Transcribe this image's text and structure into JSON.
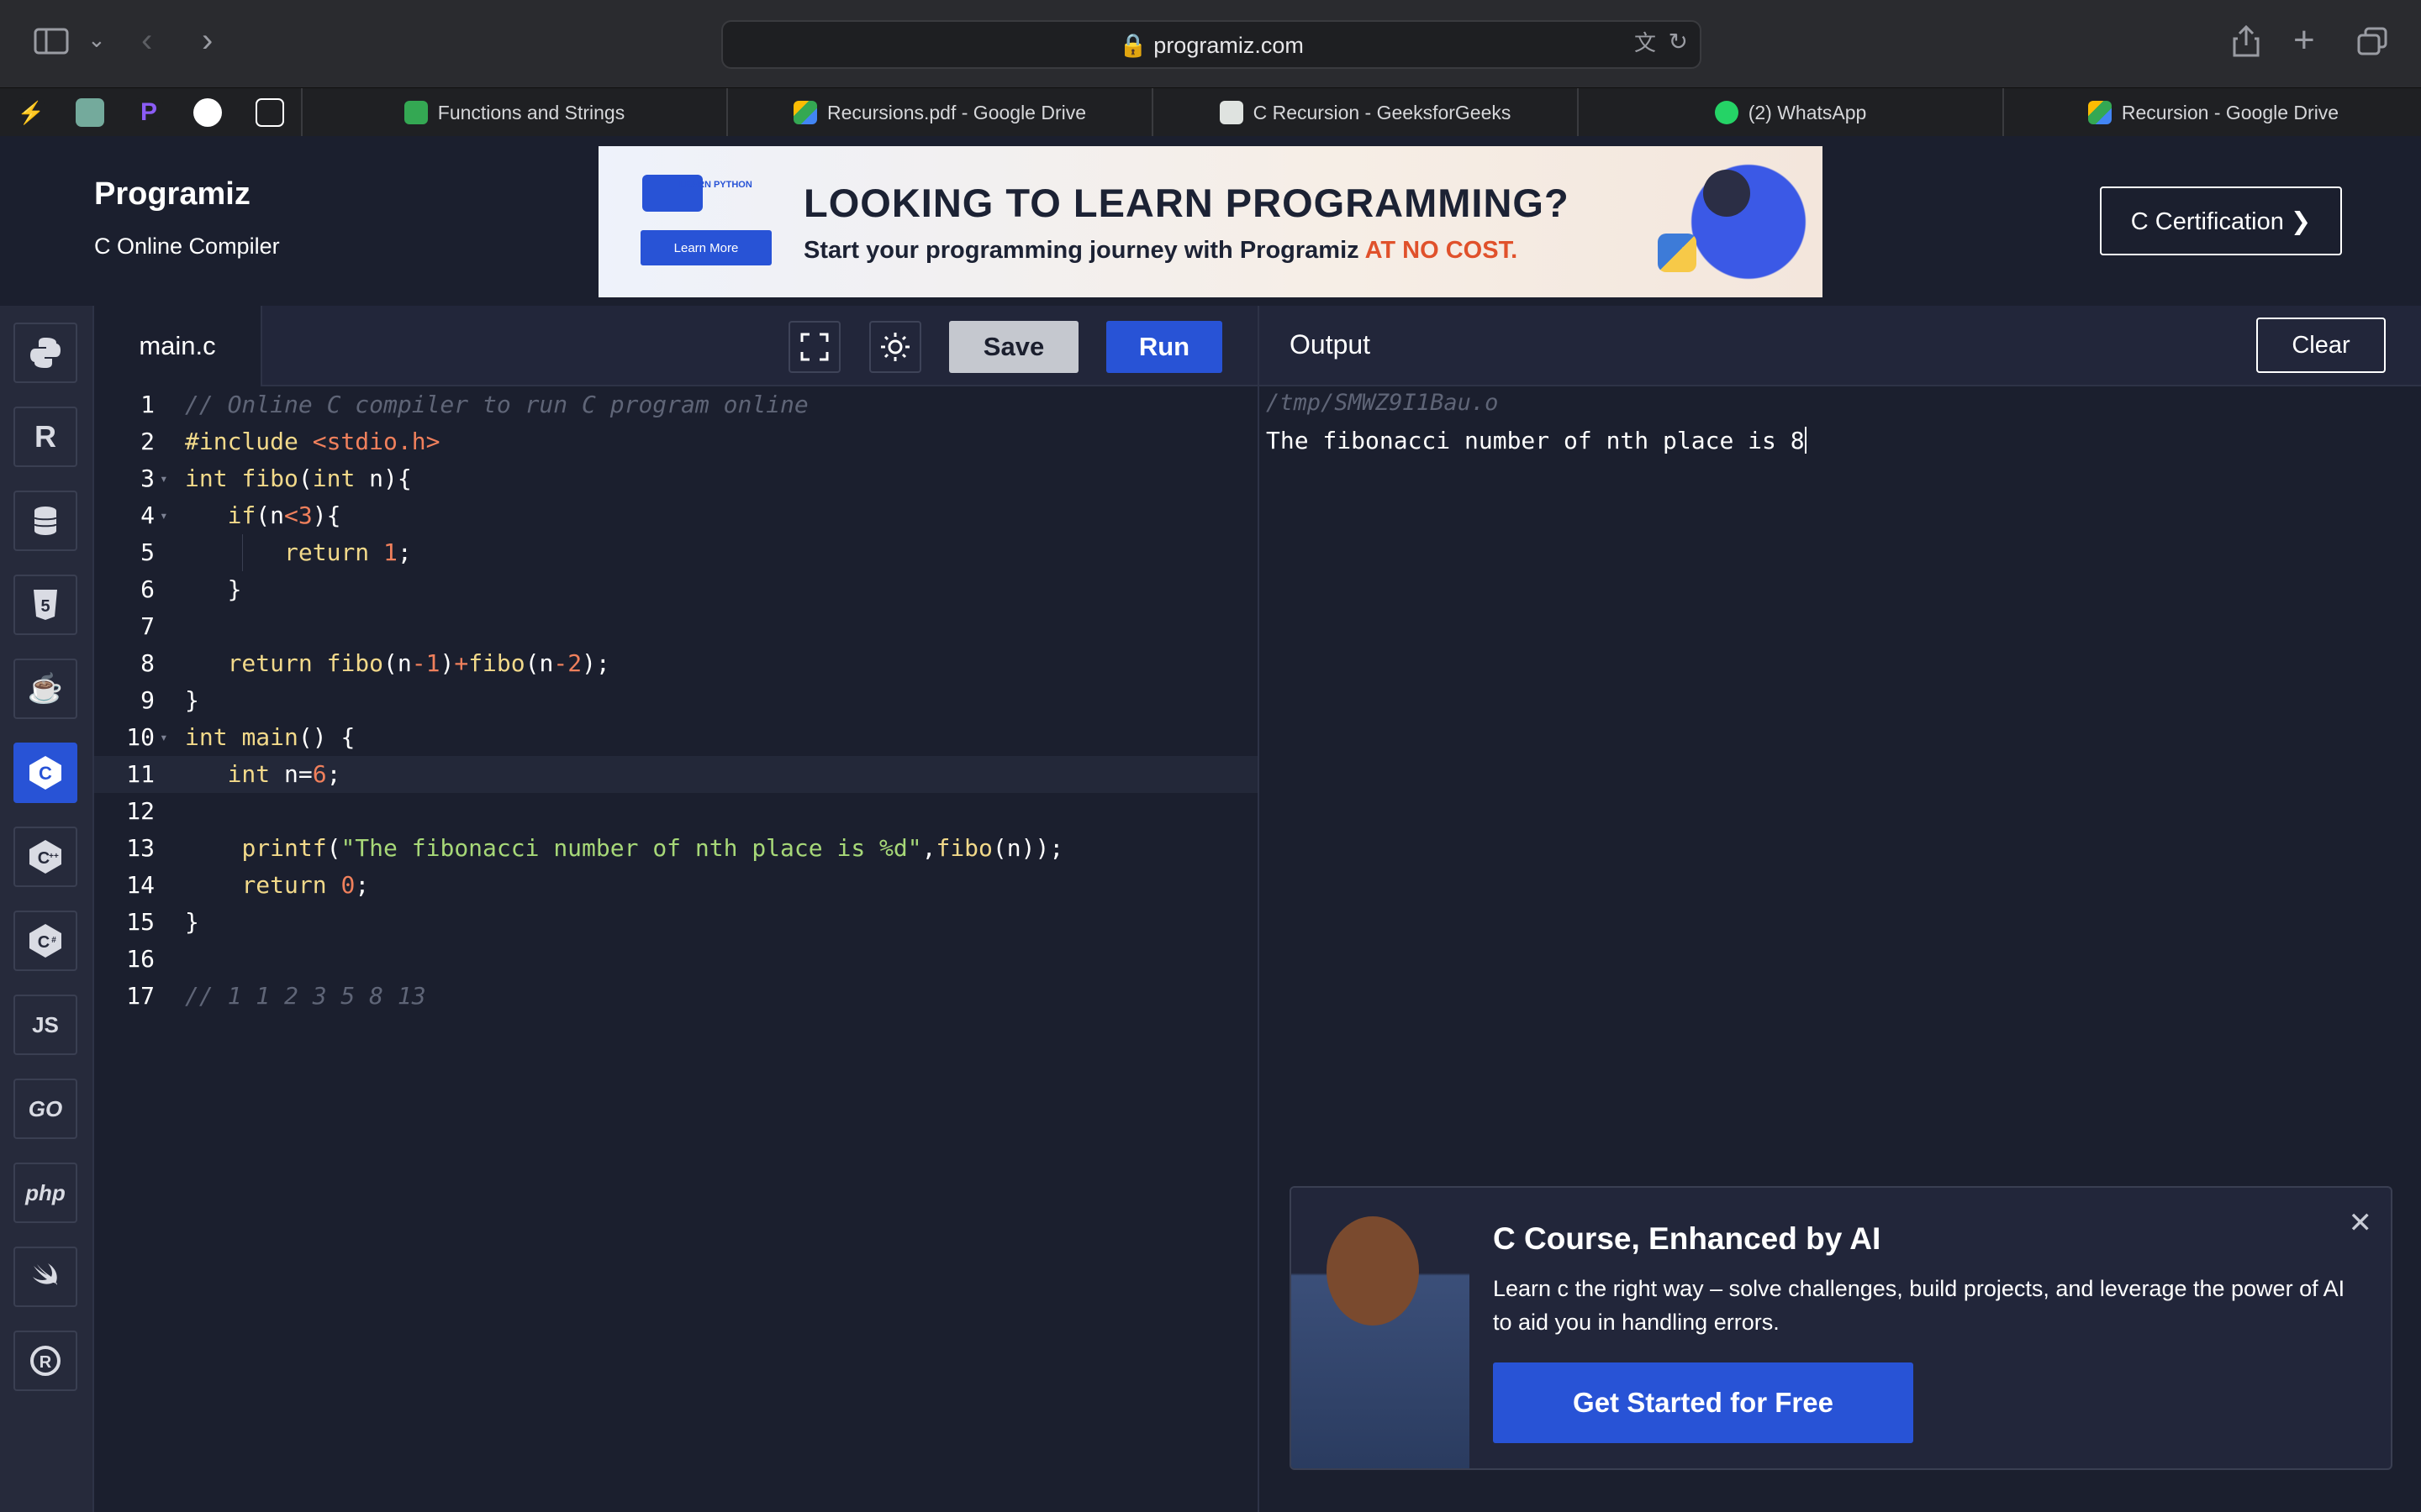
{
  "browser": {
    "url": "programiz.com",
    "tabs": [
      {
        "title": "Functions and Strings",
        "favicon_color": "#34a853"
      },
      {
        "title": "Recursions.pdf - Google Drive",
        "favicon_color": "#fbbc04"
      },
      {
        "title": "C Recursion - GeeksforGeeks",
        "favicon_color": "#2f8d46"
      },
      {
        "title": "(2) WhatsApp",
        "favicon_color": "#25d366"
      },
      {
        "title": "Recursion - Google Drive",
        "favicon_color": "#fbbc04"
      }
    ]
  },
  "site": {
    "logo": "Programiz",
    "subtitle": "C Online Compiler",
    "cert_button": "C Certification ❯"
  },
  "banner": {
    "badge": "LEARN PYTHON",
    "learn_more": "Learn More",
    "headline": "LOOKING TO LEARN PROGRAMMING?",
    "tagline_main": "Start your programming journey with Programiz ",
    "tagline_accent": "AT NO COST."
  },
  "languages": [
    "python",
    "r",
    "sql",
    "html5",
    "java",
    "c",
    "cpp",
    "csharp",
    "JS",
    "GO",
    "php",
    "swift",
    "rust"
  ],
  "editor": {
    "file_name": "main.c",
    "save_label": "Save",
    "run_label": "Run",
    "current_line": 11,
    "lines": [
      "// Online C compiler to run C program online",
      "#include <stdio.h>",
      "int fibo(int n){",
      "   if(n<3){",
      "       return 1;",
      "   }",
      "",
      "   return fibo(n-1)+fibo(n-2);",
      "}",
      "int main() {",
      "   int n=6;",
      "",
      "    printf(\"The fibonacci number of nth place is %d\",fibo(n));",
      "    return 0;",
      "}",
      "",
      "// 1 1 2 3 5 8 13"
    ]
  },
  "output": {
    "title": "Output",
    "clear_label": "Clear",
    "path": "/tmp/SMWZ9I1Bau.o",
    "result": "The fibonacci number of nth place is 8"
  },
  "promo": {
    "title": "C Course, Enhanced by AI",
    "text": "Learn c the right way – solve challenges, build projects, and leverage the power of AI to aid you in handling errors.",
    "cta": "Get Started for Free",
    "close": "✕"
  }
}
